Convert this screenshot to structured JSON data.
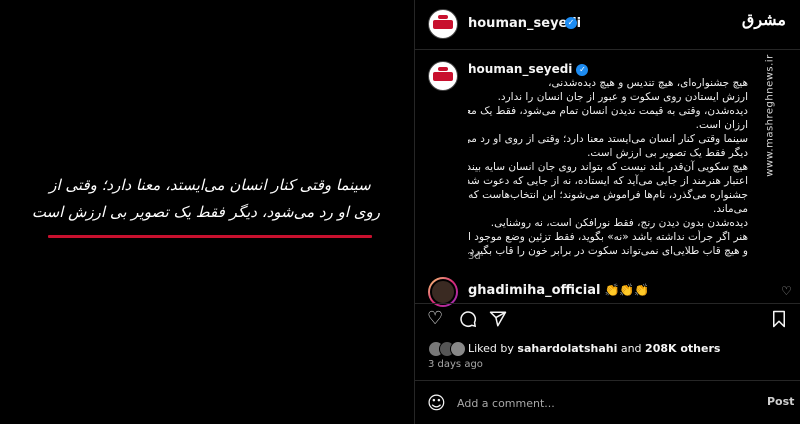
{
  "media": {
    "poem_line_1": "سینما وقتی کنار انسان می‌ایستد، معنا دارد؛ وقتی از",
    "poem_line_2": "روی او رد می‌شود، دیگر فقط یک تصویر بی ارزش است"
  },
  "header": {
    "username": "houman_seyedi"
  },
  "watermark": {
    "logo": "مشرق",
    "url": "www.mashreghnews.ir"
  },
  "caption": {
    "username": "houman_seyedi",
    "lines": [
      "هیچ جشنواره‌ای، هیچ تندیس و هیچ دیده‌شدنی،",
      "ارزش ایستادن روی سکوت و عبور از جان انسان را ندارد.",
      "دیده‌شدن، وقتی به قیمت ندیدن انسان تمام می‌شود، فقط یک معامله‌ی",
      "ارزان است.",
      "سینما وقتی کنار انسان می‌ایستد معنا دارد؛ وقتی از روی او رد می‌شود،",
      "دیگر فقط یک تصویر بی ارزش است.",
      "هیچ سکویی آن‌قدر بلند نیست که بتواند روی جان انسان سایه بیندازد.",
      "اعتبار هنرمند از جایی می‌آید که ایستاده، نه از جایی که دعوت شده.",
      "جشنواره می‌گذرد، نام‌ها فراموش می‌شوند؛ این انتخاب‌هاست که",
      "می‌ماند.",
      "دیده‌شدن بدون دیدن رنج، فقط نورافکن است، نه روشنایی.",
      "هنر اگر جرأت نداشته باشد «نه» بگوید، فقط تزئین وضع موجود است.",
      "و هیچ قاب طلایی‌ای نمی‌تواند سکوت در برابر خون را قاب بگیرد."
    ],
    "time": "3d"
  },
  "comment": {
    "username": "ghadimiha_official",
    "text": "👏👏👏"
  },
  "likes": {
    "prefix": "Liked by",
    "user": "sahardolatshahi",
    "middle": "and",
    "count": "208K others"
  },
  "post_date": "3 days ago",
  "add_comment": {
    "placeholder": "Add a comment...",
    "post_label": "Post"
  },
  "icons": {
    "like": "heart-icon",
    "comment": "comment-bubble-icon",
    "share": "send-icon",
    "save": "bookmark-icon",
    "emoji": "emoji-icon"
  },
  "colors": {
    "background": "#000000",
    "accent_red": "#c8102e",
    "verified_blue": "#1d8cf2",
    "muted_text": "#a8a8a8"
  }
}
